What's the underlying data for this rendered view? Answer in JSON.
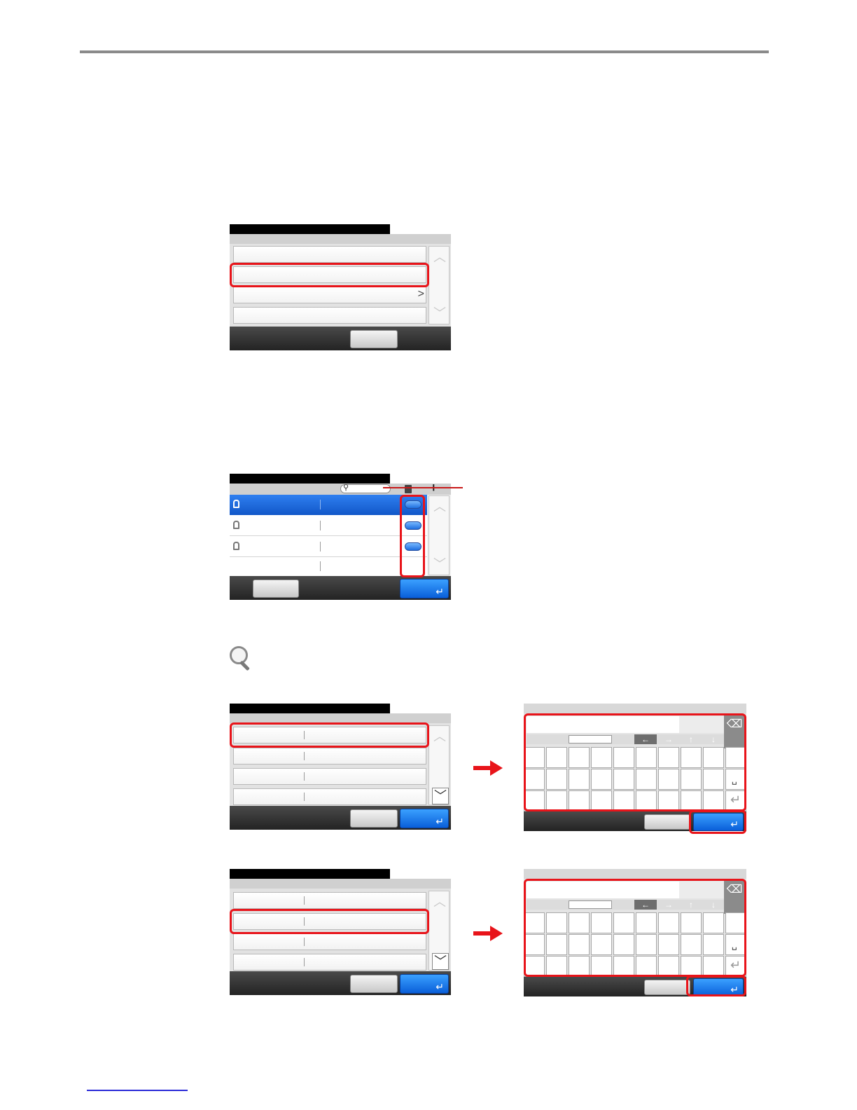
{
  "page": {
    "chevron_glyph": ">",
    "scroll_up_glyph": "︿",
    "scroll_down_glyph": "﹀",
    "enter_glyph": "↵",
    "search_glyph": "⚲",
    "plus_glyph": "+",
    "left_arrow_glyph": "←",
    "right_arrow_glyph": "→",
    "up_arrow_glyph": "↑",
    "down_arrow_glyph": "↓",
    "backspace_glyph": "⌫",
    "space_glyph": "␣",
    "accent_red": "#e8141a",
    "accent_blue": "#0a5fd9"
  }
}
